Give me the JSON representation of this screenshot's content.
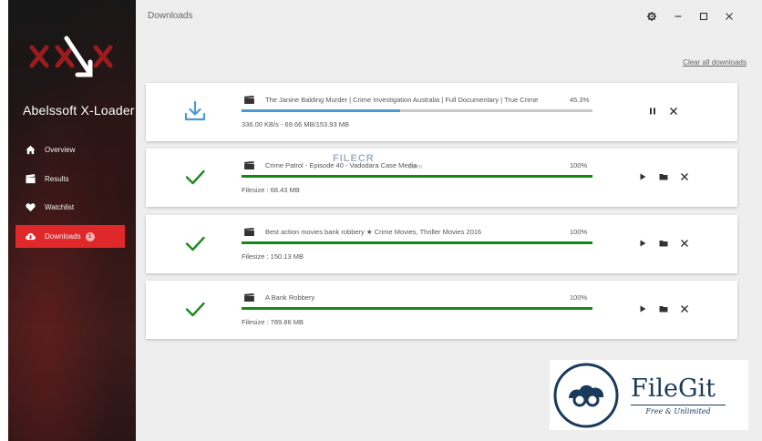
{
  "app": {
    "name": "Abelssoft X-Loader"
  },
  "nav": [
    {
      "label": "Overview",
      "icon": "home-icon"
    },
    {
      "label": "Results",
      "icon": "film-icon"
    },
    {
      "label": "Watchlist",
      "icon": "heart-icon"
    },
    {
      "label": "Downloads",
      "icon": "cloud-download-icon",
      "badge": "1",
      "active": true
    }
  ],
  "header": {
    "title": "Downloads",
    "clear_all": "Clear all downloads"
  },
  "colors": {
    "accent": "#e0272a",
    "progress_active": "#4a9ad4",
    "progress_done": "#138a13",
    "check": "#1f8a1f"
  },
  "downloads": [
    {
      "title": "The Janine Balding Murder | Crime Investigation Australia | Full Documentary | True Crime",
      "percent": "45.3%",
      "progress": 0.453,
      "meta": "336.00 KB/s - 69.66 MB/153.93 MB",
      "status": "downloading"
    },
    {
      "title": "Crime Patrol - Episode 40 - Vadodara Case Media",
      "percent": "100%",
      "progress": 1,
      "meta": "Filesize : 68.43 MB",
      "status": "done"
    },
    {
      "title": "Best action movies bank robbery ★ Crime Movies, Thriller Movies 2016",
      "percent": "100%",
      "progress": 1,
      "meta": "Filesize : 150.13 MB",
      "status": "done"
    },
    {
      "title": "A Bank Robbery",
      "percent": "100%",
      "progress": 1,
      "meta": "Filesize : 789.86 MB",
      "status": "done"
    }
  ],
  "watermark": {
    "text": "FILECR",
    "sub": ".com"
  },
  "filegit": {
    "name": "FileGit",
    "tagline": "Free & Unlimited"
  }
}
